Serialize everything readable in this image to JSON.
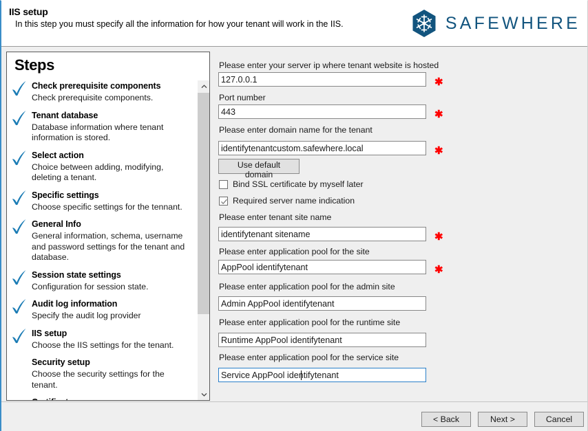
{
  "window": {
    "accent_blue": "#3a8dc8",
    "panel_bg": "#efefef"
  },
  "header": {
    "title": "IIS setup",
    "subtitle": "In this step you must specify all the information for how your tenant will work in the IIS.",
    "logo_text": "SAFEWHERE",
    "logo_color": "#12547e",
    "logo_icon": "hexagon-snowflake-icon"
  },
  "steps": {
    "title": "Steps",
    "check_color": "#1b7cb5",
    "items": [
      {
        "name": "Check prerequisite components",
        "desc": "Check prerequisite components.",
        "done": true
      },
      {
        "name": "Tenant database",
        "desc": "Database information where tenant information is stored.",
        "done": true
      },
      {
        "name": "Select action",
        "desc": "Choice between adding, modifying, deleting a tenant.",
        "done": true
      },
      {
        "name": "Specific settings",
        "desc": "Choose specific settings for the tennant.",
        "done": true
      },
      {
        "name": "General Info",
        "desc": "General information, schema, username and password settings for the tenant and database.",
        "done": true
      },
      {
        "name": "Session state settings",
        "desc": "Configuration for session state.",
        "done": true
      },
      {
        "name": "Audit log information",
        "desc": "Specify the audit log provider",
        "done": true
      },
      {
        "name": "IIS setup",
        "desc": "Choose the IIS settings for the tenant.",
        "done": true
      },
      {
        "name": "Security setup",
        "desc": "Choose the security settings for the tenant.",
        "done": false
      },
      {
        "name": "Certificates",
        "desc": "",
        "done": false
      }
    ],
    "scrollbar": {
      "up_icon": "chevron-up-icon",
      "down_icon": "chevron-down-icon"
    }
  },
  "form": {
    "required_marker": "✱",
    "required_color": "#ff0000",
    "fields": [
      {
        "label": "Please enter your server ip where tenant website is hosted",
        "value": "127.0.0.1",
        "required": true,
        "focused": false
      },
      {
        "label": "Port number",
        "value": "443",
        "required": true,
        "focused": false
      },
      {
        "label": "Please enter domain name for the tenant",
        "value": "identifytenantcustom.safewhere.local",
        "required": true,
        "focused": false
      },
      {
        "label": "Please enter tenant site name",
        "value": "identifytenant sitename",
        "required": true,
        "focused": false
      },
      {
        "label": "Please enter application pool for the site",
        "value": "AppPool identifytenant",
        "required": true,
        "focused": false
      },
      {
        "label": "Please enter application pool for the admin site",
        "value": "Admin AppPool identifytenant",
        "required": false,
        "focused": false
      },
      {
        "label": "Please enter application pool for the runtime site",
        "value": "Runtime AppPool identifytenant",
        "required": false,
        "focused": false
      },
      {
        "label": "Please enter application pool for the service site",
        "value": "Service AppPool identifytenant",
        "required": false,
        "focused": true
      }
    ],
    "use_default_domain_button": "Use default domain",
    "checkboxes": [
      {
        "label": "Bind SSL certificate by myself later",
        "checked": false
      },
      {
        "label": "Required server name indication",
        "checked": true
      }
    ]
  },
  "footer": {
    "back": "< Back",
    "next": "Next >",
    "cancel": "Cancel"
  }
}
